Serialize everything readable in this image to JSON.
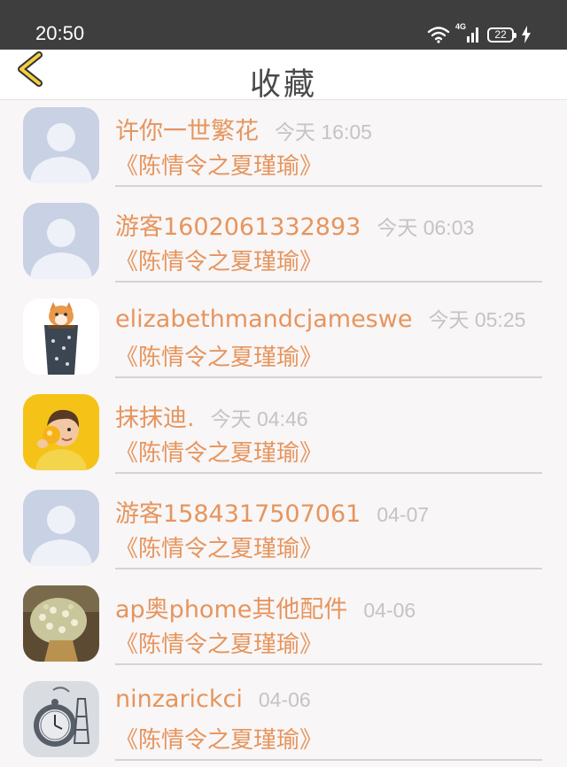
{
  "status_bar": {
    "time": "20:50",
    "network_label": "4G",
    "battery_level": "22"
  },
  "header": {
    "title": "收藏",
    "back_icon": "chevron-left-icon"
  },
  "colors": {
    "accent": "#e6955d",
    "time_gray": "#c4c4c4",
    "title_gray": "#4a4a4a",
    "status_bar": "#3e3e3e"
  },
  "favorites": [
    {
      "user": "许你一世繁花",
      "time": "今天 16:05",
      "book": "《陈情令之夏瑾瑜》",
      "avatar": "default-avatar"
    },
    {
      "user": "游客1602061332893",
      "time": "今天 06:03",
      "book": "《陈情令之夏瑾瑜》",
      "avatar": "default-avatar"
    },
    {
      "user": "elizabethmandcjameswe",
      "time": "今天 05:25",
      "book": "《陈情令之夏瑾瑜》",
      "avatar": "cat-photo"
    },
    {
      "user": "抹抹迪.",
      "time": "今天 04:46",
      "book": "《陈情令之夏瑾瑜》",
      "avatar": "child-photo"
    },
    {
      "user": "游客1584317507061",
      "time": "04-07",
      "book": "《陈情令之夏瑾瑜》",
      "avatar": "default-avatar"
    },
    {
      "user": "ap奥phome其他配件",
      "time": "04-06",
      "book": "《陈情令之夏瑾瑜》",
      "avatar": "flowers-photo"
    },
    {
      "user": "ninzarickci",
      "time": "04-06",
      "book": "《陈情令之夏瑾瑜》",
      "avatar": "pocket-watch-photo"
    }
  ]
}
